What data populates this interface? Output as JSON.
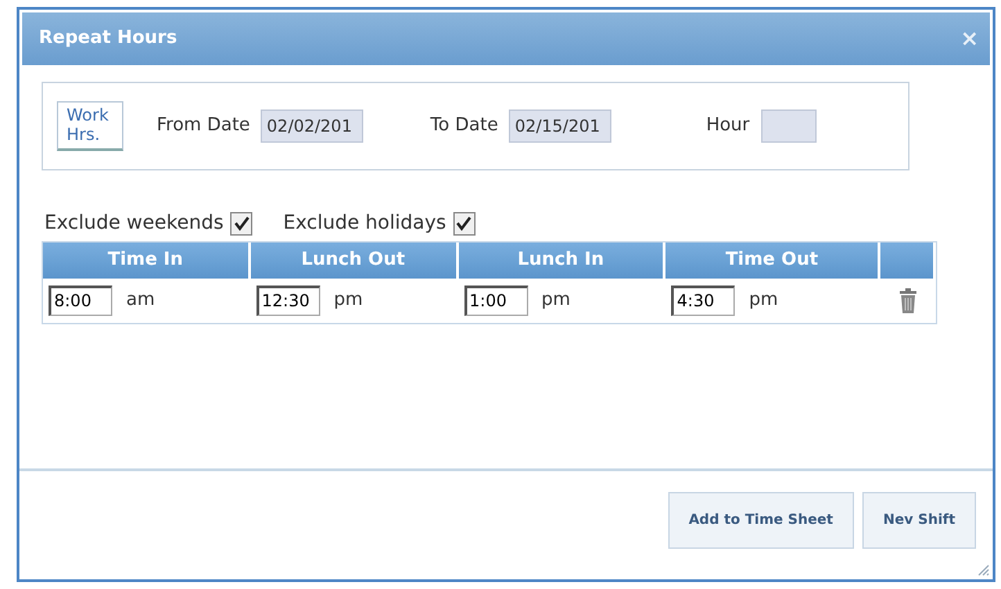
{
  "window": {
    "title": "Repeat Hours",
    "close": "×"
  },
  "filters": {
    "work_hours_button": "Work Hrs.",
    "from_date": {
      "label": "From Date",
      "value": "02/02/201"
    },
    "to_date": {
      "label": "To Date",
      "value": "02/15/201"
    },
    "hour": {
      "label": "Hour"
    }
  },
  "options": [
    {
      "label": "Exclude weekends",
      "checked": true
    },
    {
      "label": "Exclude holidays",
      "checked": true
    }
  ],
  "table": {
    "columns": [
      "Time In",
      "Lunch Out",
      "Lunch In",
      "Time Out"
    ],
    "rows": [
      {
        "times": [
          {
            "value": "8:00",
            "meridiem": "am"
          },
          {
            "value": "12:30",
            "meridiem": "pm"
          },
          {
            "value": "1:00",
            "meridiem": "pm"
          },
          {
            "value": "4:30",
            "meridiem": "pm"
          }
        ]
      }
    ]
  },
  "buttons": [
    "Add to Time Sheet",
    "Nev Shift"
  ]
}
